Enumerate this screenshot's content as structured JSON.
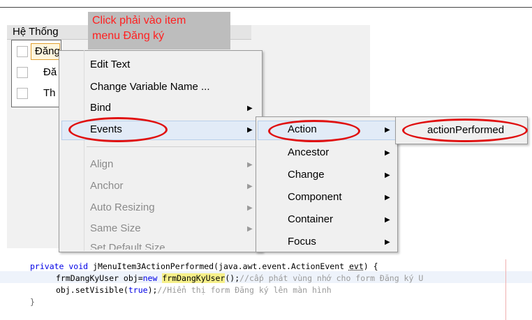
{
  "callout": {
    "line1": "Click phải vào item",
    "line2": "menu Đăng ký"
  },
  "form": {
    "menu_title": "Hệ Thống",
    "items": [
      "Đăng ký",
      "Đă",
      "Th"
    ]
  },
  "context_menu": {
    "items": [
      {
        "label": "Edit Text",
        "enabled": true,
        "submenu": false
      },
      {
        "label": "Change Variable Name ...",
        "enabled": true,
        "submenu": false
      },
      {
        "label": "Bind",
        "enabled": true,
        "submenu": true
      },
      {
        "label": "Events",
        "enabled": true,
        "submenu": true,
        "highlighted": true
      },
      {
        "label": "Align",
        "enabled": false,
        "submenu": true
      },
      {
        "label": "Anchor",
        "enabled": false,
        "submenu": true
      },
      {
        "label": "Auto Resizing",
        "enabled": false,
        "submenu": true
      },
      {
        "label": "Same Size",
        "enabled": false,
        "submenu": true
      },
      {
        "label": "Set Default Size",
        "enabled": false,
        "submenu": false
      }
    ]
  },
  "events_menu": {
    "items": [
      {
        "label": "Action",
        "highlighted": true
      },
      {
        "label": "Ancestor"
      },
      {
        "label": "Change"
      },
      {
        "label": "Component"
      },
      {
        "label": "Container"
      },
      {
        "label": "Focus"
      }
    ]
  },
  "action_menu": {
    "items": [
      {
        "label": "actionPerformed"
      }
    ]
  },
  "code": {
    "line1_kw": "private void",
    "line1_rest": " jMenuItem3ActionPerformed(java.awt.event.ActionEvent ",
    "line1_evt": "evt",
    "line1_end": ") {",
    "line2_a": "frmDangKyUser obj=",
    "line2_new": "new",
    "line2_cls": "frmDangKyUser",
    "line2_b": "();",
    "line2_comment": "//cấp phát vùng nhớ cho form Đăng ký U",
    "line3_a": "obj.setVisible(",
    "line3_true": "true",
    "line3_b": ");",
    "line3_comment": "//Hiển thị form Đăng ký lên màn hình",
    "line4": "}"
  },
  "colors": {
    "annotation": "#e01010",
    "keyword": "#0000e6",
    "comment": "#9a9a9a",
    "callout_text": "#ff2020"
  }
}
